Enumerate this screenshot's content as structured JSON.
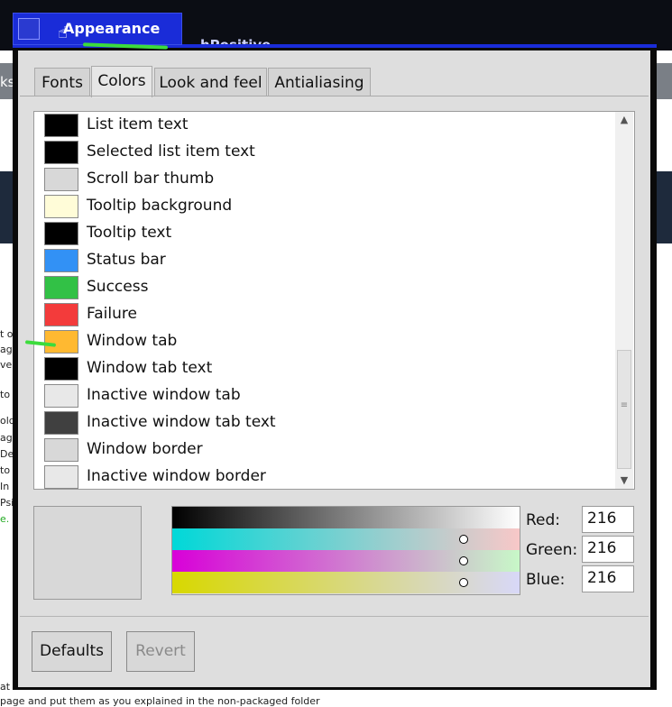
{
  "window": {
    "title": "Appearance"
  },
  "tabs": [
    "Fonts",
    "Colors",
    "Look and feel",
    "Antialiasing"
  ],
  "active_tab": "Colors",
  "color_items": [
    {
      "label": "List item text",
      "color": "#000000"
    },
    {
      "label": "Selected list item text",
      "color": "#000000"
    },
    {
      "label": "Scroll bar thumb",
      "color": "#d8d8d8"
    },
    {
      "label": "Tooltip background",
      "color": "#fffcd8"
    },
    {
      "label": "Tooltip text",
      "color": "#000000"
    },
    {
      "label": "Status bar",
      "color": "#3291f5"
    },
    {
      "label": "Success",
      "color": "#32c146"
    },
    {
      "label": "Failure",
      "color": "#f33b3b"
    },
    {
      "label": "Window tab",
      "color": "#ffb931"
    },
    {
      "label": "Window tab text",
      "color": "#000000"
    },
    {
      "label": "Inactive window tab",
      "color": "#e8e8e8"
    },
    {
      "label": "Inactive window tab text",
      "color": "#404040"
    },
    {
      "label": "Window border",
      "color": "#d8d8d8"
    },
    {
      "label": "Inactive window border",
      "color": "#e8e8e8"
    }
  ],
  "rgb": {
    "red_label": "Red:",
    "red": "216",
    "green_label": "Green:",
    "green": "216",
    "blue_label": "Blue:",
    "blue": "216"
  },
  "buttons": {
    "defaults": "Defaults",
    "revert": "Revert"
  },
  "background": {
    "title_fragment": "hPositive",
    "tab_fragment": "ks",
    "texts": [
      "t o",
      "ag",
      "ve",
      "to",
      "old",
      "age",
      "De",
      "to",
      "In",
      "Psi",
      "e.",
      "at",
      "page and put them as you explained in the non-packaged folder"
    ]
  }
}
